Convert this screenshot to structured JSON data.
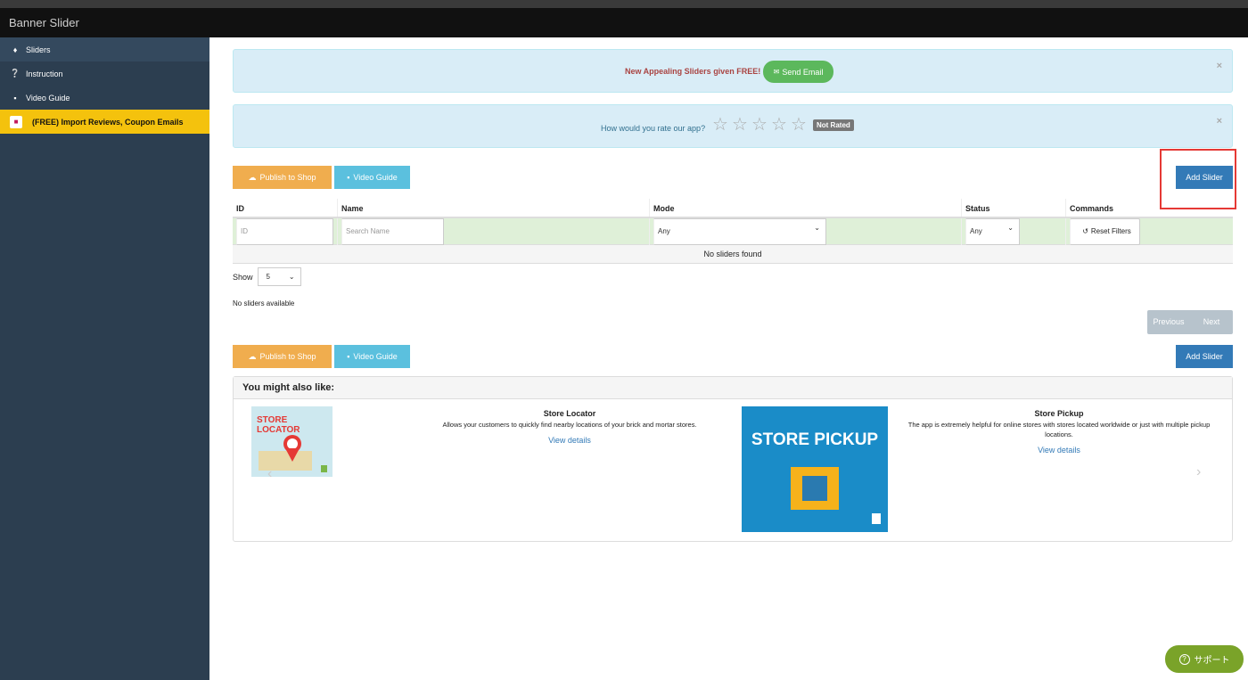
{
  "app": {
    "title": "Banner Slider"
  },
  "sidebar": {
    "items": [
      {
        "label": "Sliders",
        "icon": "tags-icon"
      },
      {
        "label": "Instruction",
        "icon": "question-circle-icon"
      },
      {
        "label": "Video Guide",
        "icon": "video-camera-icon"
      },
      {
        "label": "(FREE) Import Reviews, Coupon Emails",
        "icon": "gift-icon"
      }
    ]
  },
  "alerts": {
    "promo_text": "New Appealing Sliders given FREE!",
    "send_email_label": "Send Email",
    "rate_question": "How would you rate our app?",
    "rating_badge": "Not Rated",
    "close_symbol": "×"
  },
  "toolbar": {
    "publish_label": "Publish to Shop",
    "video_label": "Video Guide",
    "add_label": "Add Slider"
  },
  "table": {
    "columns": [
      "ID",
      "Name",
      "Mode",
      "Status",
      "Commands"
    ],
    "filters": {
      "id_placeholder": "ID",
      "name_placeholder": "Search Name",
      "mode_value": "Any",
      "status_value": "Any",
      "reset_label": "Reset Filters"
    },
    "empty_message": "No sliders found"
  },
  "pagination": {
    "show_label": "Show",
    "page_size": "5",
    "summary": "No sliders available",
    "previous_label": "Previous",
    "next_label": "Next"
  },
  "suggestions": {
    "heading": "You might also like:",
    "items": [
      {
        "title": "Store Locator",
        "description": "Allows your customers to quickly find nearby locations of your brick and mortar stores.",
        "link": "View details",
        "image_text": "STORE LOCATOR"
      },
      {
        "title": "Store Pickup",
        "description": "The app is extremely helpful for online stores with stores located worldwide or just with multiple pickup locations.",
        "link": "View details",
        "image_text": "STORE PICKUP"
      }
    ]
  },
  "support": {
    "label": "サポート"
  },
  "colors": {
    "sidebar_bg": "#2c3e50",
    "promo_bg": "#f4c20d",
    "publish": "#f0ad4e",
    "video": "#5bc0de",
    "add": "#337ab7",
    "send_email": "#5cb85c",
    "highlight": "#e53935"
  }
}
